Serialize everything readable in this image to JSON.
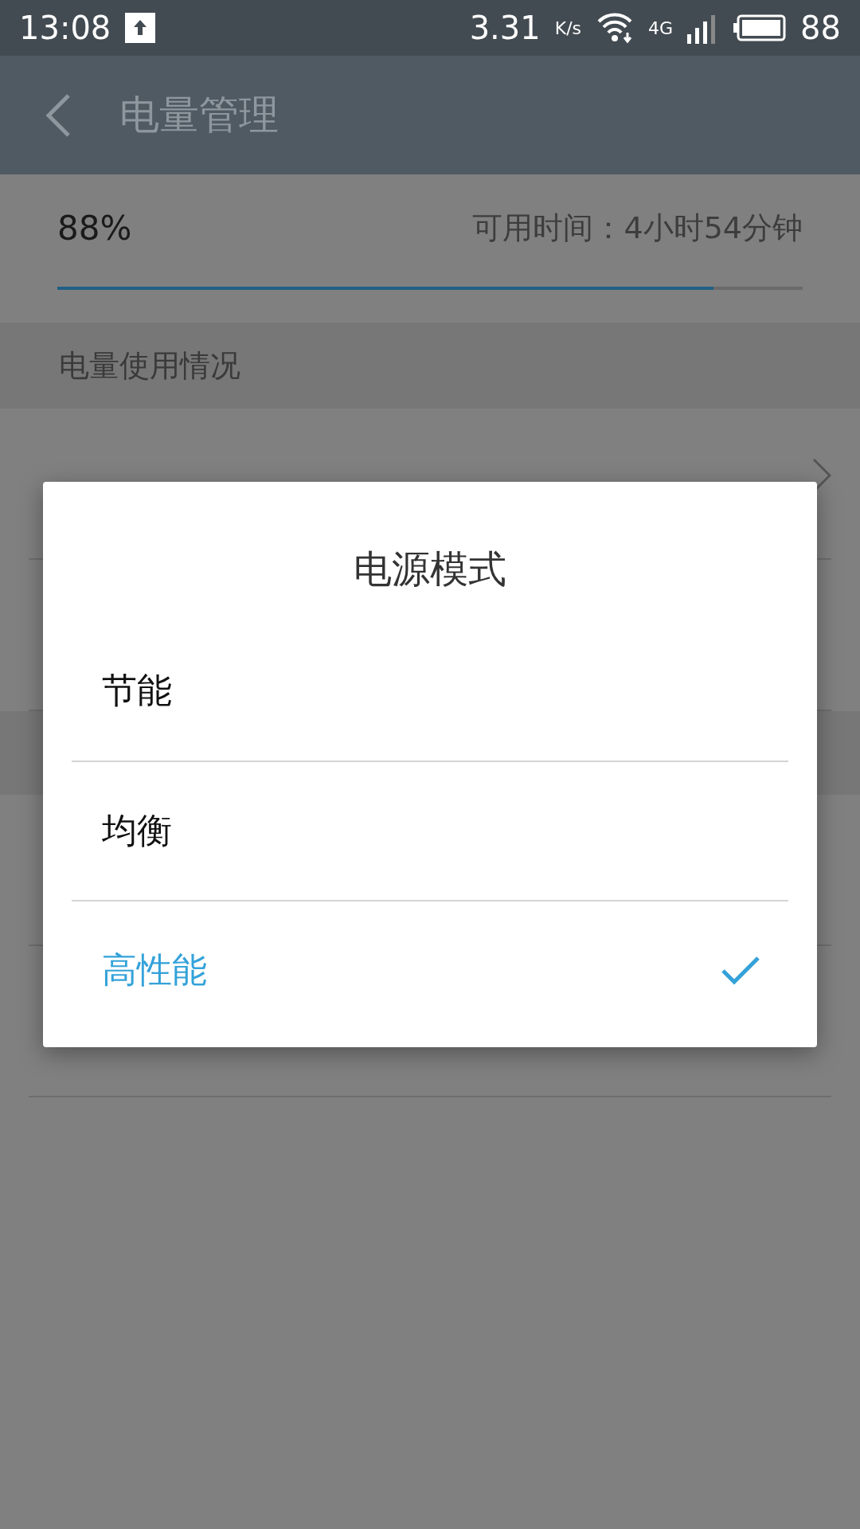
{
  "status_bar": {
    "time": "13:08",
    "speed": "3.31",
    "speed_unit": "K/s",
    "network": "4G",
    "battery": "88"
  },
  "app_bar": {
    "title": "电量管理"
  },
  "battery": {
    "percent": "88%",
    "remaining": "可用时间：4小时54分钟",
    "level": 0.88
  },
  "section_header": "电量使用情况",
  "dialog": {
    "title": "电源模式",
    "options": [
      {
        "label": "节能",
        "selected": false
      },
      {
        "label": "均衡",
        "selected": false
      },
      {
        "label": "高性能",
        "selected": true
      }
    ]
  }
}
